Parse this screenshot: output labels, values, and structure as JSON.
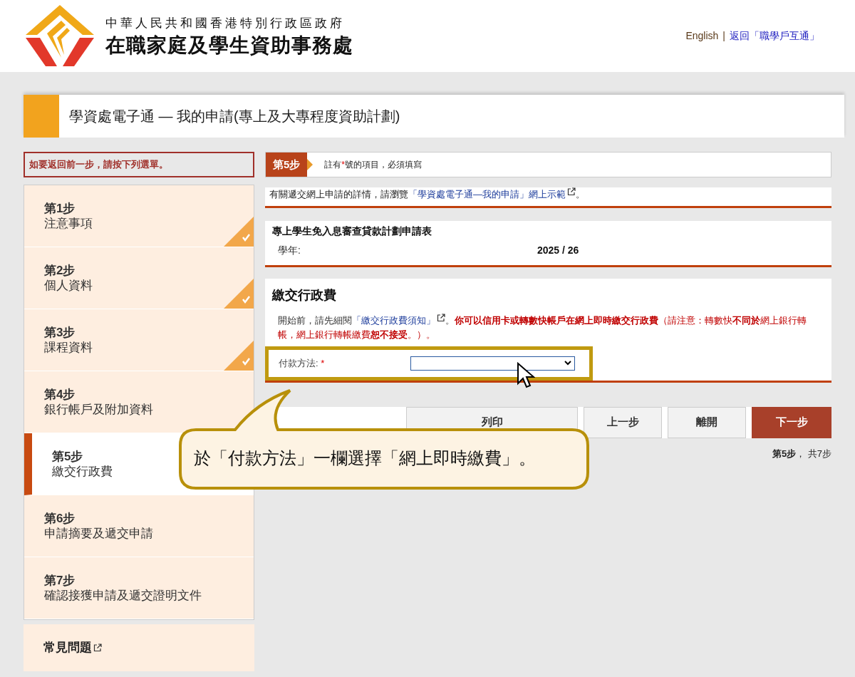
{
  "header": {
    "org_line": "中華人民共和國香港特別行政區政府",
    "agency": "在職家庭及學生資助事務處",
    "links": [
      {
        "label": "English",
        "kind": "plain"
      },
      {
        "label": "|",
        "kind": "separator"
      },
      {
        "label": "返回「職學戶互通」",
        "kind": "link"
      }
    ]
  },
  "page_title": "學資處電子通 — 我的申請(專上及大專程度資助計劃)",
  "sidebar": {
    "back_note": "如要返回前一步，請按下列選單。",
    "steps": [
      {
        "step": "第1步",
        "name": "注意事項",
        "completed": true,
        "selected": false
      },
      {
        "step": "第2步",
        "name": "個人資料",
        "completed": true,
        "selected": false
      },
      {
        "step": "第3步",
        "name": "課程資料",
        "completed": true,
        "selected": false
      },
      {
        "step": "第4步",
        "name": "銀行帳戶及附加資料",
        "completed": false,
        "selected": false
      },
      {
        "step": "第5步",
        "name": "繳交行政費",
        "completed": false,
        "selected": true
      },
      {
        "step": "第6步",
        "name": "申請摘要及遞交申請",
        "completed": false,
        "selected": false
      },
      {
        "step": "第7步",
        "name": "確認接獲申請及遞交證明文件",
        "completed": false,
        "selected": false
      }
    ],
    "faq": "常見問題"
  },
  "step_bar": {
    "badge": "第5步",
    "note_before": "註有",
    "asterisk": "*",
    "note_after": "號的項目，必須填寫"
  },
  "info": {
    "before": "有關遞交網上申請的詳情，請瀏覽",
    "link": "「學資處電子通—我的申請」網上示範",
    "after": "。"
  },
  "form_card": {
    "title": "專上學生免入息審查貸款計劃申請表",
    "label": "學年:",
    "value": "2025 / 26"
  },
  "fee_section": {
    "title": "繳交行政費",
    "intro": "開始前，請先細閱",
    "link": "「繳交行政費須知」",
    "after_link": "。",
    "warning": "**你可以信用卡或轉數快帳戶在網上即時繳交行政費**（請注意：轉數快**不同於**網上銀行轉帳，網上銀行轉帳繳費**恕不接受**。）。",
    "field": {
      "label": "付款方法:",
      "required": true,
      "highlighted": true
    }
  },
  "buttons": [
    {
      "label": "列印",
      "kind": "wide"
    },
    {
      "label": "上一步",
      "kind": "normal"
    },
    {
      "label": "離開",
      "kind": "normal"
    },
    {
      "label": "下一步",
      "kind": "primary"
    }
  ],
  "progress": {
    "current": "第5步",
    "sep": "，",
    "total": "共7步"
  },
  "callout": {
    "text": "於「付款方法」一欄選擇「網上即時繳費」。"
  }
}
